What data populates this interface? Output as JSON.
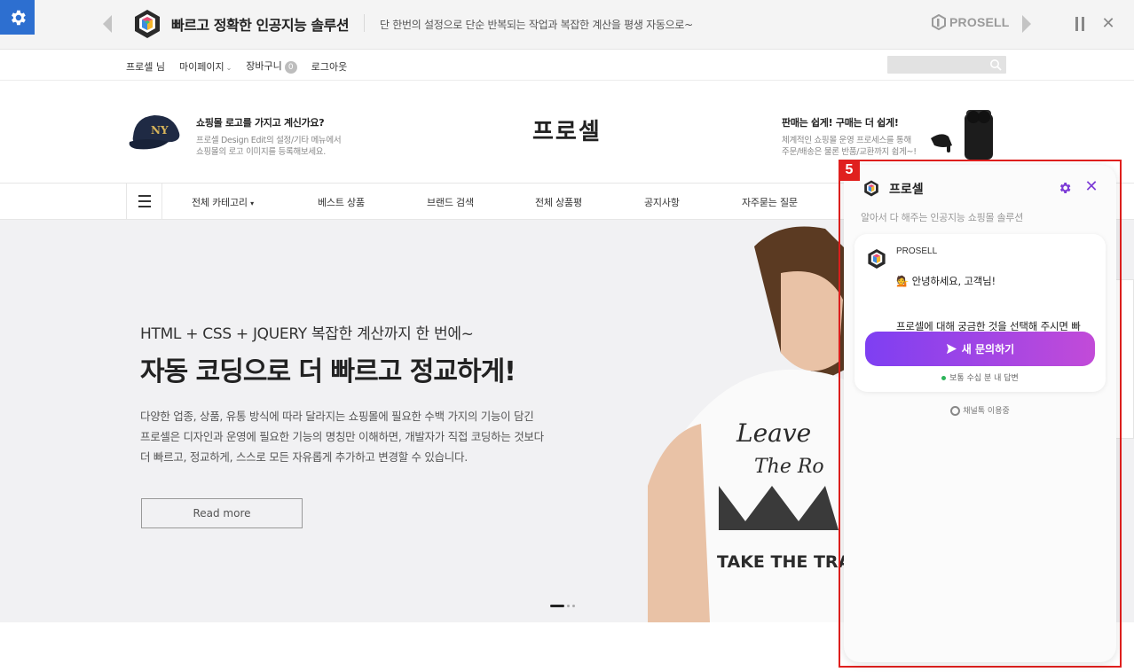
{
  "promo_bar": {
    "title": "빠르고 정확한 인공지능 솔루션",
    "subtitle": "단 한번의 설정으로 단순 반복되는 작업과 복잡한 계산을 평생 자동으로~",
    "brand": "PROSELL"
  },
  "util_nav": {
    "user": "프로셀 님",
    "mypage": "마이페이지",
    "cart": "장바구니",
    "cart_count": "0",
    "logout": "로그아웃"
  },
  "header": {
    "left_promo": {
      "title": "쇼핑몰 로고를 가지고 계신가요?",
      "desc1": "프로셀 Design Edit의 설정/기타 메뉴에서",
      "desc2": "쇼핑몰의 로고 이미지를 등록해보세요."
    },
    "logo": "프로셀",
    "right_promo": {
      "title": "판매는 쉽게! 구매는 더 쉽게!",
      "desc1": "체계적인 쇼핑몰 운영 프로세스를 통해",
      "desc2": "주문/배송은 물론 반품/교환까지 쉽게~!"
    }
  },
  "main_nav": {
    "items": [
      "전체 카테고리",
      "베스트 상품",
      "브랜드 검색",
      "전체 상품평",
      "공지사항",
      "자주묻는 질문"
    ]
  },
  "hero": {
    "subtitle": "HTML + CSS + JQUERY 복잡한 계산까지 한 번에~",
    "title": "자동 코딩으로 더 빠르고 정교하게!",
    "desc1": "다양한 업종, 상품, 유통 방식에 따라 달라지는 쇼핑몰에 필요한 수백 가지의 기능이 담긴",
    "desc2": "프로셀은 디자인과 운영에 필요한 기능의 명칭만 이해하면, 개발자가 직접 코딩하는 것보다",
    "desc3": "더 빠르고, 정교하게, 스스로 모든 자유롭게 추가하고 변경할 수 있습니다.",
    "button": "Read more"
  },
  "chat": {
    "badge": "5",
    "name": "프로셀",
    "tagline": "알아서 다 해주는 인공지능 쇼핑몰 솔루션",
    "from": "PROSELL",
    "greeting": "💁 안녕하세요, 고객님!",
    "message": "프로셀에 대해 궁금한 것을 선택해 주시면 빠르게 안내해 드릴게요~",
    "new_inquiry": "새 문의하기",
    "reply_note": "보통 수십 분 내 답변",
    "channel": "채널톡 이용중"
  },
  "colors": {
    "accent": "#2d6fd0",
    "chat_purple": "#7e3ff2",
    "highlight_red": "#e0201e"
  }
}
